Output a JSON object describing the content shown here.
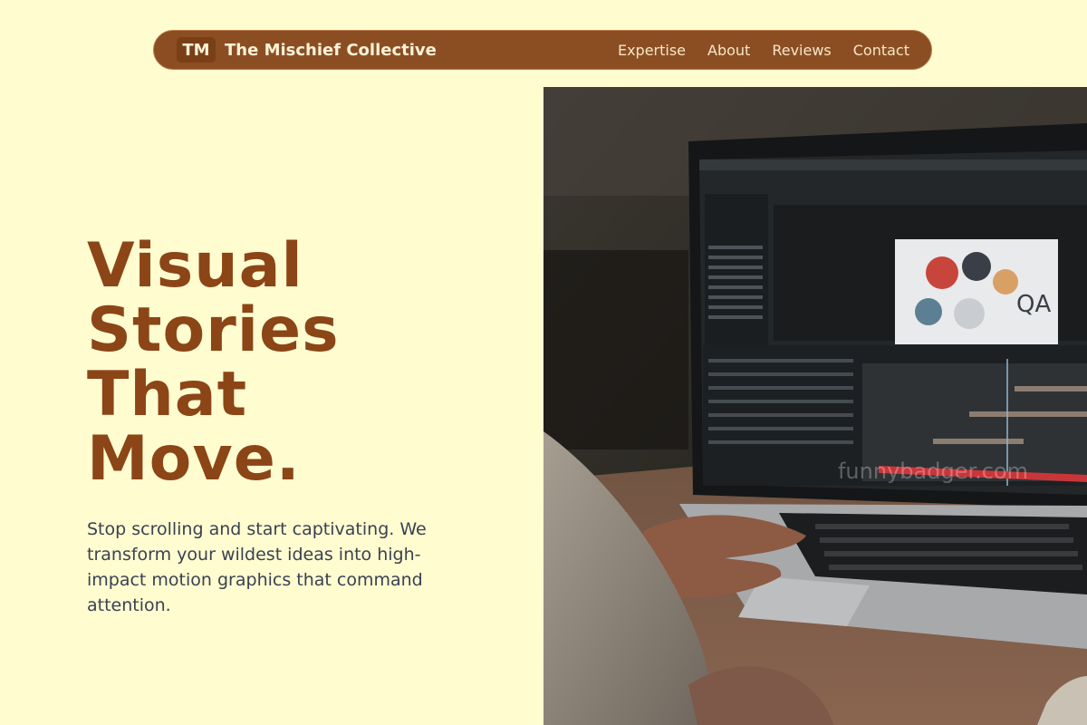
{
  "nav": {
    "logo_initials": "TM",
    "brand_name": "The Mischief Collective",
    "links": [
      {
        "label": "Expertise"
      },
      {
        "label": "About"
      },
      {
        "label": "Reviews"
      },
      {
        "label": "Contact"
      }
    ]
  },
  "hero": {
    "headline_lines": [
      "Visual",
      "Stories",
      "That",
      "Move."
    ],
    "subtext": "Stop scrolling and start captivating. We transform your wildest ideas into high-impact motion graphics that command attention.",
    "image": {
      "description_icon": "laptop-photo",
      "watermark": "funnybadger.com",
      "preview_text": "QA"
    }
  }
}
